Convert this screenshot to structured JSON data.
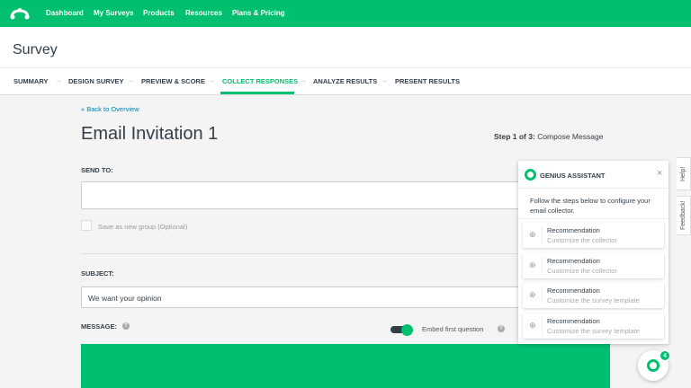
{
  "nav": {
    "items": [
      "Dashboard",
      "My Surveys",
      "Products",
      "Resources",
      "Plans & Pricing"
    ],
    "brand_color": "#00bf6f",
    "logo_icon": "surveymonkey-logo"
  },
  "page_title": "Survey",
  "tabs": [
    {
      "label": "SUMMARY"
    },
    {
      "label": "DESIGN SURVEY"
    },
    {
      "label": "PREVIEW & SCORE"
    },
    {
      "label": "COLLECT RESPONSES",
      "active": true
    },
    {
      "label": "ANALYZE RESULTS"
    },
    {
      "label": "PRESENT RESULTS"
    }
  ],
  "main": {
    "back_link": "« Back to Overview",
    "heading": "Email Invitation 1",
    "step_prefix": "Step 1 of 3:",
    "step_label": "Compose Message",
    "send_to_label": "SEND TO:",
    "send_to_value": "",
    "save_group_label": "Save as new group (Optional)",
    "subject_label": "SUBJECT:",
    "subject_value": "We want your opinion",
    "message_label": "MESSAGE:",
    "embed_label": "Embed first question",
    "embed_on": true
  },
  "assistant": {
    "title": "GENIUS ASSISTANT",
    "intro": "Follow the steps below to configure your email collector.",
    "items": [
      {
        "title": "Recommendation",
        "sub": "Customize the collector"
      },
      {
        "title": "Recommendation",
        "sub": "Customize the collector"
      },
      {
        "title": "Recommendation",
        "sub": "Customize the survey template"
      },
      {
        "title": "Recommendation",
        "sub": "Customize the survey template"
      }
    ],
    "badge": "4"
  },
  "side_tabs": {
    "help": "Help!",
    "feedback": "Feedback!"
  }
}
